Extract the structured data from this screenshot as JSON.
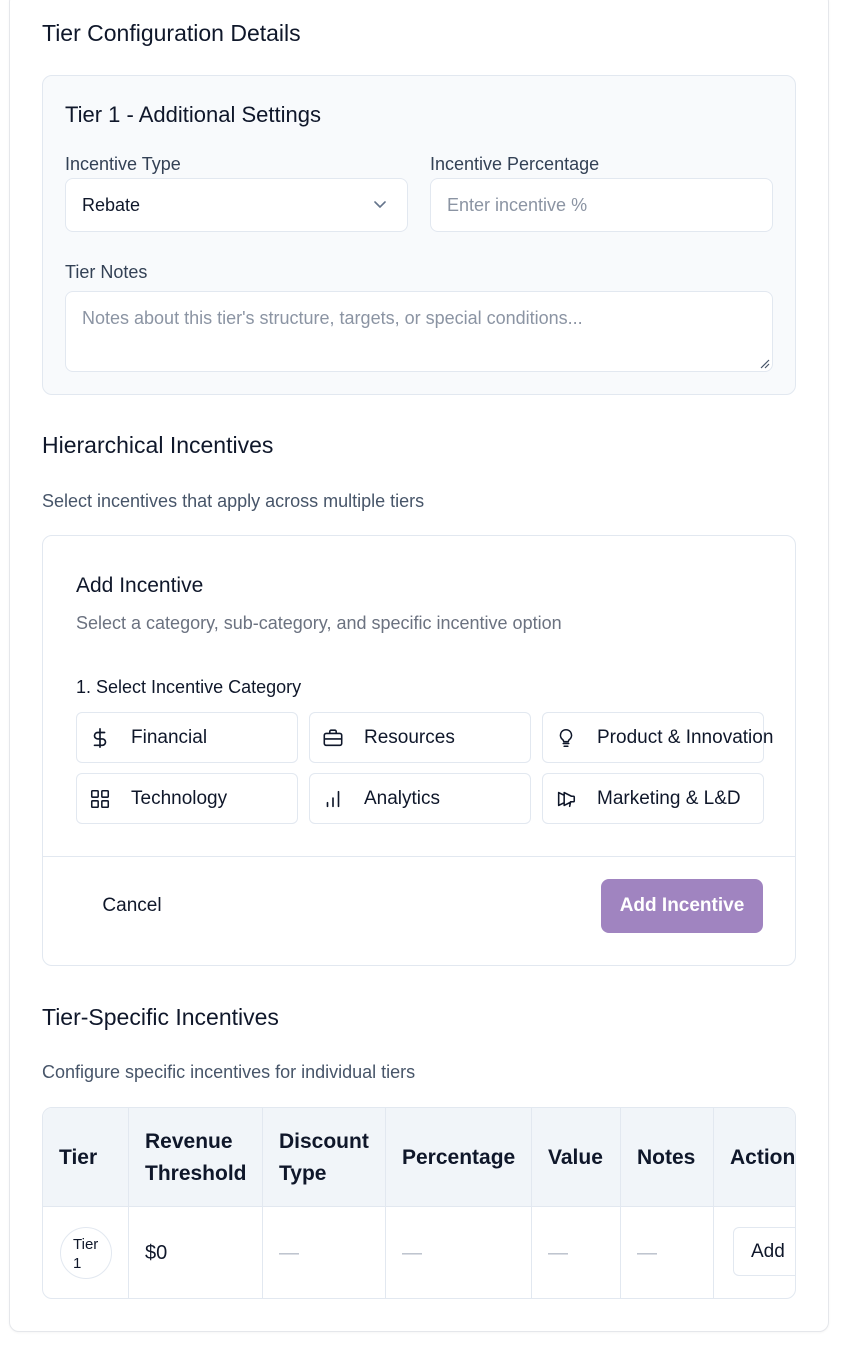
{
  "tier_config": {
    "title": "Tier Configuration Details",
    "panel_title": "Tier 1 - Additional Settings",
    "incentive_type": {
      "label": "Incentive Type",
      "value": "Rebate"
    },
    "incentive_percentage": {
      "label": "Incentive Percentage",
      "placeholder": "Enter incentive %"
    },
    "tier_notes": {
      "label": "Tier Notes",
      "placeholder": "Notes about this tier's structure, targets, or special conditions..."
    }
  },
  "hierarchical": {
    "title": "Hierarchical Incentives",
    "subtitle": "Select incentives that apply across multiple tiers",
    "card": {
      "title": "Add Incentive",
      "subtitle": "Select a category, sub-category, and specific incentive option",
      "step_label": "1. Select Incentive Category",
      "categories": [
        {
          "label": "Financial",
          "icon": "dollar-icon"
        },
        {
          "label": "Resources",
          "icon": "briefcase-icon"
        },
        {
          "label": "Product & Innovation",
          "icon": "lightbulb-icon"
        },
        {
          "label": "Technology",
          "icon": "grid-icon"
        },
        {
          "label": "Analytics",
          "icon": "bar-chart-icon"
        },
        {
          "label": "Marketing & L&D",
          "icon": "megaphone-icon"
        }
      ],
      "cancel_label": "Cancel",
      "add_label": "Add Incentive"
    }
  },
  "tier_specific": {
    "title": "Tier-Specific Incentives",
    "subtitle": "Configure specific incentives for individual tiers",
    "columns": {
      "tier": "Tier",
      "revenue_l1": "Revenue",
      "revenue_l2": "Threshold",
      "discount_l1": "Discount",
      "discount_l2": "Type",
      "percentage": "Percentage",
      "value": "Value",
      "notes": "Notes",
      "actions": "Actions"
    },
    "rows": [
      {
        "tier_l1": "Tier",
        "tier_l2": "1",
        "revenue": "$0",
        "discount": "—",
        "percentage": "—",
        "value": "—",
        "notes": "—",
        "action": "Add"
      }
    ]
  },
  "colors": {
    "accent": "#a084c0",
    "panel_bg": "#f8fafc",
    "border": "#e2e8f0"
  }
}
